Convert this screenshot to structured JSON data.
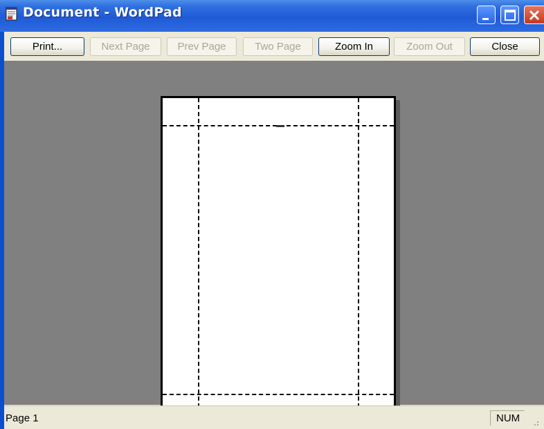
{
  "window": {
    "title": "Document - WordPad"
  },
  "toolbar": {
    "buttons": [
      {
        "label": "Print...",
        "enabled": true
      },
      {
        "label": "Next Page",
        "enabled": false
      },
      {
        "label": "Prev Page",
        "enabled": false
      },
      {
        "label": "Two Page",
        "enabled": false
      },
      {
        "label": "Zoom In",
        "enabled": true
      },
      {
        "label": "Zoom Out",
        "enabled": false
      },
      {
        "label": "Close",
        "enabled": true
      }
    ]
  },
  "statusbar": {
    "page": "Page 1",
    "num": "NUM"
  },
  "icons": [
    "wordpad-app-icon",
    "minimize-icon",
    "maximize-icon",
    "close-icon",
    "resize-grip-icon"
  ],
  "colors": {
    "titlebar": "#1f5ad6",
    "preview_background": "#808080",
    "chrome": "#ece9d8",
    "close_button": "#c3391c"
  }
}
